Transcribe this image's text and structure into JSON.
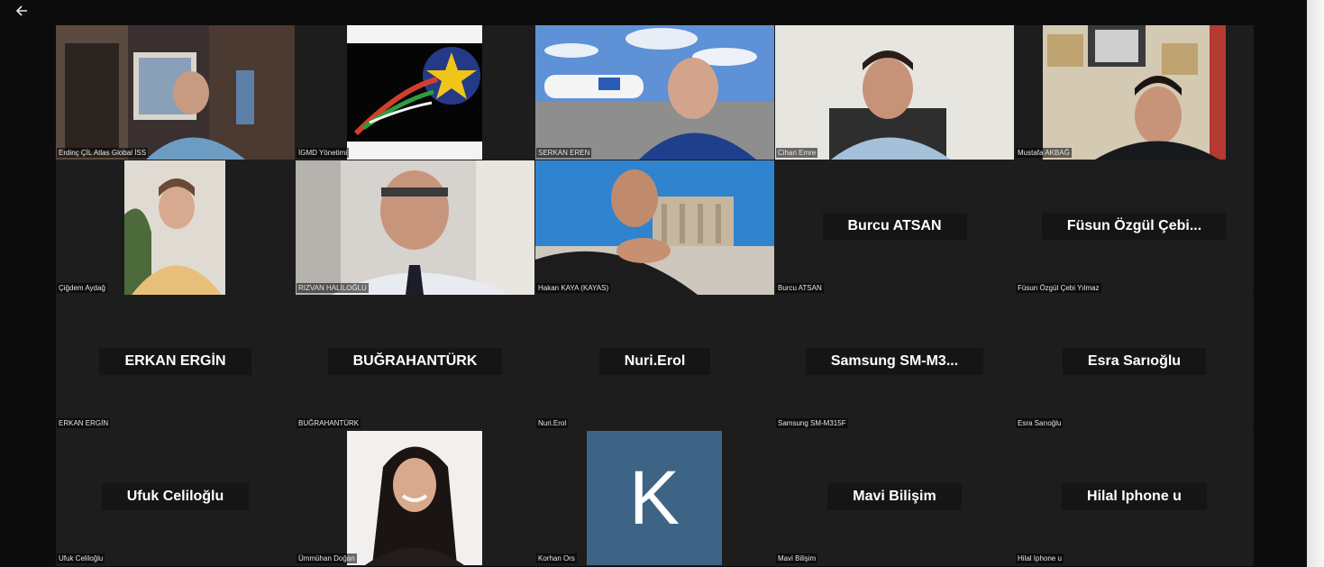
{
  "app": {
    "back_icon": "arrow-left-icon"
  },
  "colors": {
    "meeting_bg": "#0c0c0c",
    "tile_bg": "#1d1d1d",
    "avatar_k": "#3e6485"
  },
  "participants": [
    {
      "tag": "Erdinç ÇİL Atlas Global İSS"
    },
    {
      "tag": "İGMD Yönetimi"
    },
    {
      "tag": "SERKAN EREN"
    },
    {
      "tag": "Cihan Emre"
    },
    {
      "tag": "Mustafa AKBAĞ"
    },
    {
      "tag": "Çiğdem Aydağ"
    },
    {
      "tag": "RIZVAN HALİLOĞLU"
    },
    {
      "tag": "Hakan KAYA (KAYAS)"
    },
    {
      "display": "Burcu ATSAN",
      "tag": "Burcu ATSAN"
    },
    {
      "display": "Füsun Özgül Çebi...",
      "tag": "Füsun Özgül Çebi Yılmaz"
    },
    {
      "display": "ERKAN ERGİN",
      "tag": "ERKAN ERGİN"
    },
    {
      "display": "BUĞRAHANTÜRK",
      "tag": "BUĞRAHANTÜRK"
    },
    {
      "display": "Nuri.Erol",
      "tag": "Nuri.Erol"
    },
    {
      "display": "Samsung  SM-M3...",
      "tag": "Samsung SM-M315F"
    },
    {
      "display": "Esra Sarıoğlu",
      "tag": "Esra Sarıoğlu"
    },
    {
      "display": "Ufuk Celiloğlu",
      "tag": "Ufuk Celiloğlu"
    },
    {
      "tag": "Ümmühan Doğan"
    },
    {
      "avatar_letter": "K",
      "tag": "Korhan Ors"
    },
    {
      "display": "Mavi Bilişim",
      "tag": "Mavi Bilişim"
    },
    {
      "display": "Hilal Iphone u",
      "tag": "Hilal Iphone u"
    }
  ]
}
